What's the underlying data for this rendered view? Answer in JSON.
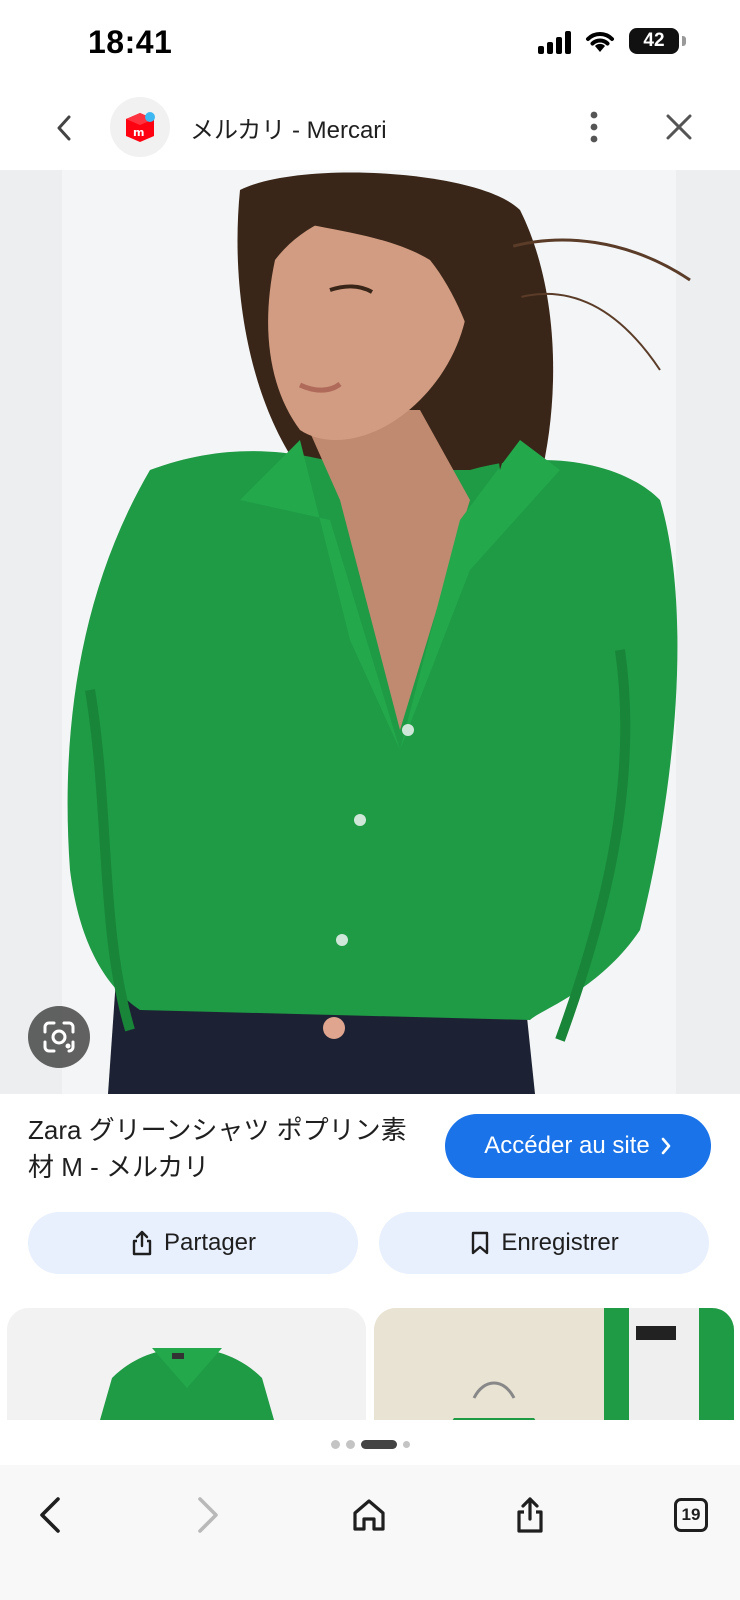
{
  "status_bar": {
    "time": "18:41",
    "battery_level": "42",
    "icons": [
      "signal-icon",
      "wifi-icon",
      "battery-icon"
    ]
  },
  "header": {
    "site_title": "メルカリ - Mercari",
    "logo_icon": "mercari-logo-icon",
    "brand_color": "#ff0211"
  },
  "product": {
    "title": "Zara グリーンシャツ ポプリン素材 M - メルカリ",
    "shirt_color": "#1f9a45"
  },
  "buttons": {
    "visit_site": "Accéder au site",
    "share": "Partager",
    "save": "Enregistrer"
  },
  "colors": {
    "accent": "#1a73e8",
    "pill_bg": "#e8f0fe"
  },
  "pager": {
    "dots": 4,
    "active_index": 2
  },
  "bottom_bar": {
    "tab_count": "19"
  }
}
